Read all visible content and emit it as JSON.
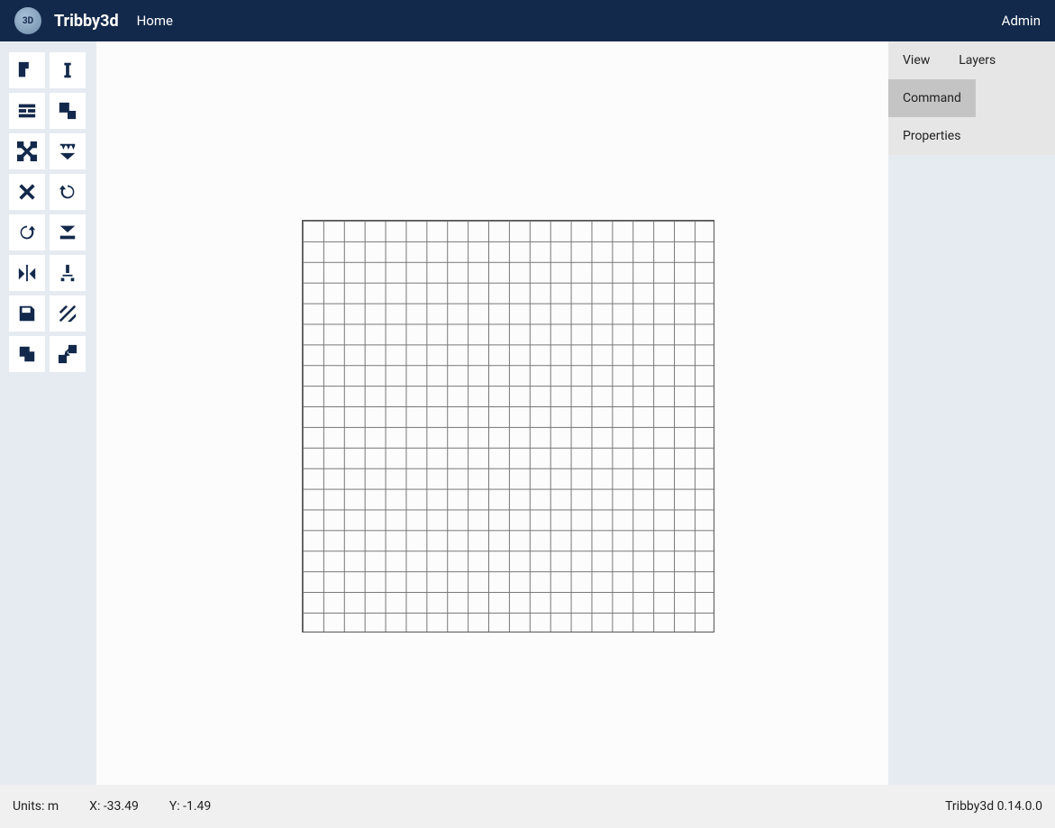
{
  "header": {
    "brand": "Tribby3d",
    "nav_home": "Home",
    "nav_admin": "Admin"
  },
  "toolbar": {
    "tools": [
      {
        "name": "slab-tool",
        "icon": "slab"
      },
      {
        "name": "column-tool",
        "icon": "column"
      },
      {
        "name": "wall-tool",
        "icon": "wall"
      },
      {
        "name": "opening-tool",
        "icon": "opening"
      },
      {
        "name": "trim-tool",
        "icon": "trim"
      },
      {
        "name": "load-uniform-tool",
        "icon": "load-uniform"
      },
      {
        "name": "delete-tool",
        "icon": "close"
      },
      {
        "name": "undo-tool",
        "icon": "undo"
      },
      {
        "name": "redo-tool",
        "icon": "redo"
      },
      {
        "name": "load-line-tool",
        "icon": "load-line"
      },
      {
        "name": "mirror-tool",
        "icon": "mirror"
      },
      {
        "name": "support-tool",
        "icon": "support"
      },
      {
        "name": "save-tool",
        "icon": "save"
      },
      {
        "name": "hatch-tool",
        "icon": "hatch"
      },
      {
        "name": "copy-tool",
        "icon": "copy"
      },
      {
        "name": "move-tool",
        "icon": "move"
      }
    ]
  },
  "right_panel": {
    "tabs_row1": [
      "View",
      "Layers"
    ],
    "tabs_row2": [
      "Command",
      "Properties"
    ],
    "active_tab": "Command"
  },
  "statusbar": {
    "units_label": "Units: m",
    "x_label": "X: -33.49",
    "y_label": "Y: -1.49",
    "version": "Tribby3d 0.14.0.0"
  }
}
